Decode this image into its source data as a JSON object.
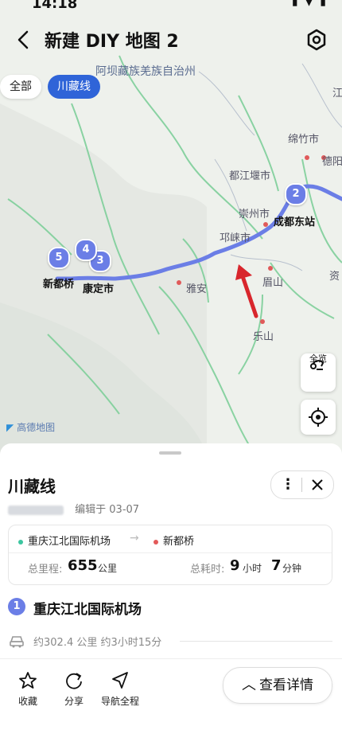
{
  "status": {
    "time": "14:18"
  },
  "header": {
    "title": "新建 DIY 地图 2"
  },
  "chips": {
    "all": "全部",
    "active": "川藏线"
  },
  "map": {
    "labels": {
      "aba": "阿坝藏族羌族自治州",
      "mianzhu": "绵竹市",
      "deyang": "德阳",
      "dujiangyan": "都江堰市",
      "chongzhou": "崇州市",
      "chengdu_east": "成都东站",
      "qionglai": "邛崃市",
      "meishan": "眉山",
      "ziyang": "资",
      "yaan": "雅安",
      "leshan": "乐山",
      "xinduqiao": "新都桥",
      "kangding": "康定市",
      "jiang": "江"
    },
    "markers": [
      "2",
      "3",
      "4",
      "5"
    ],
    "overview_label": "全览",
    "logo_text": "高德地图",
    "route_color": "#6b7ee6"
  },
  "sheet": {
    "route_name": "川藏线",
    "edited": "编辑于 03-07",
    "start": "重庆江北国际机场",
    "end": "新都桥",
    "distance_label": "总里程:",
    "distance_value": "655",
    "distance_unit": "公里",
    "time_label": "总耗时:",
    "time_hours": "9",
    "time_hours_unit": "小时",
    "time_minutes": "7",
    "time_minutes_unit": "分钟",
    "waypoint_number": "1",
    "waypoint_name": "重庆江北国际机场",
    "leg_info": "约302.4 公里 约3小时15分"
  },
  "actions": {
    "favorite": "收藏",
    "share": "分享",
    "navigate": "导航全程",
    "details": "查看详情"
  }
}
